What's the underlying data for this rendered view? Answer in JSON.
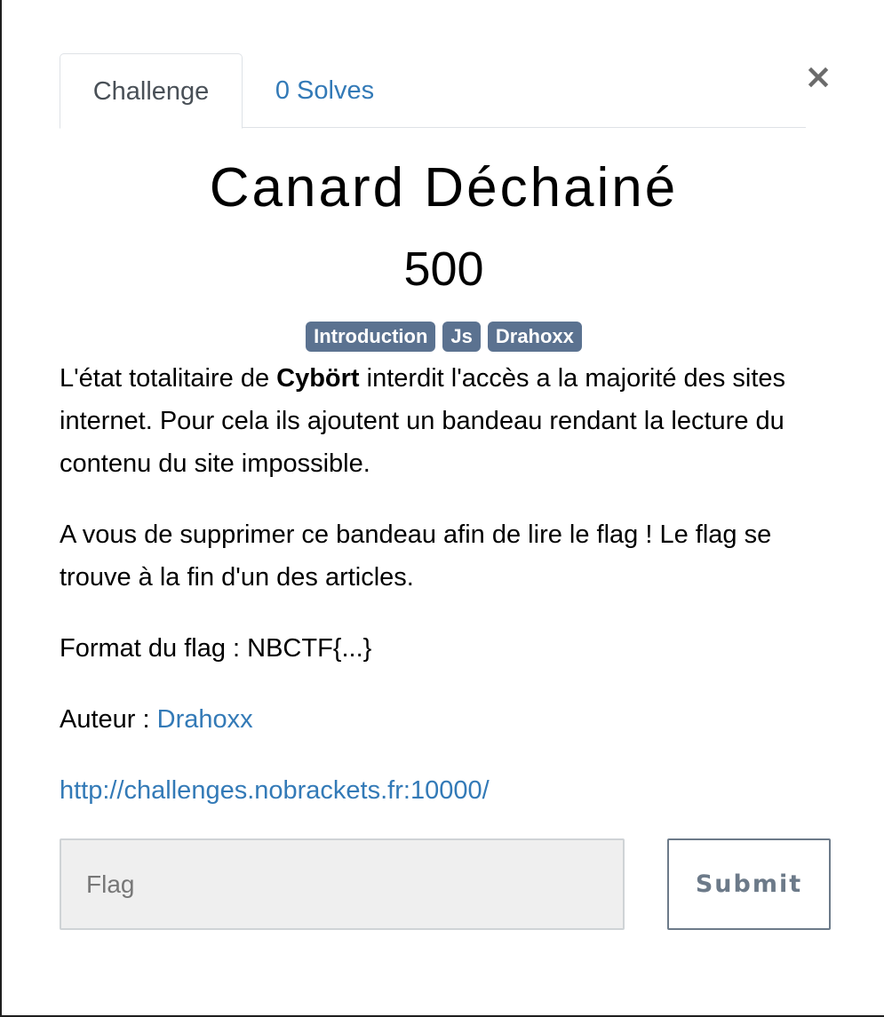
{
  "modal": {
    "close_label": "×"
  },
  "tabs": [
    {
      "label": "Challenge"
    },
    {
      "label": "0 Solves"
    }
  ],
  "challenge": {
    "title": "Canard Déchainé",
    "points": "500",
    "tags": [
      "Introduction",
      "Js",
      "Drahoxx"
    ],
    "description": {
      "p1_before": "L'état totalitaire de ",
      "p1_bold": "Cybört",
      "p1_after": " interdit l'accès a la majorité des sites internet. Pour cela ils ajoutent un bandeau rendant la lecture du contenu du site impossible.",
      "p2": "A vous de supprimer ce bandeau afin de lire le flag ! Le flag se trouve à la fin d'un des articles.",
      "p3": "Format du flag : NBCTF{...}",
      "author_label": "Auteur : ",
      "author_link": "Drahoxx",
      "url": "http://challenges.nobrackets.fr:10000/"
    }
  },
  "form": {
    "flag_placeholder": "Flag",
    "submit_label": "Submit"
  },
  "colors": {
    "link": "#337ab7",
    "tag_bg": "#5b7290",
    "submit_border": "#6c7a89"
  }
}
